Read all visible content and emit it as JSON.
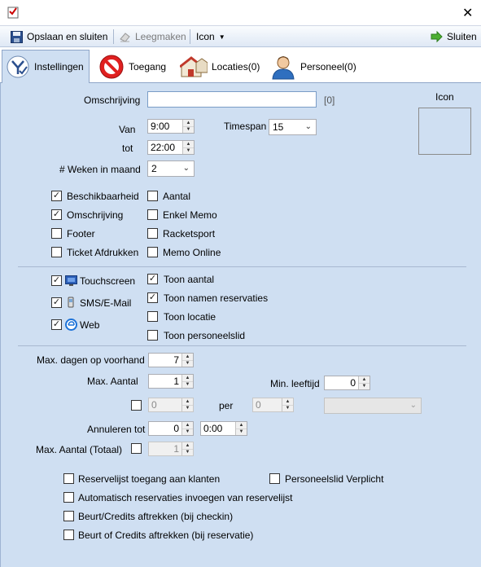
{
  "window": {
    "close_symbol": "✕"
  },
  "toolbar": {
    "save_close": "Opslaan en sluiten",
    "clear": "Leegmaken",
    "icon": "Icon",
    "close": "Sluiten"
  },
  "tabs": [
    {
      "label": "Instellingen",
      "active": true
    },
    {
      "label": "Toegang"
    },
    {
      "label": "Locaties(0)"
    },
    {
      "label": "Personeel(0)"
    }
  ],
  "form": {
    "omschrijving_label": "Omschrijving",
    "omschrijving_value": "",
    "omschrijving_count": "[0]",
    "icon_label": "Icon",
    "van_label": "Van",
    "van_value": "9:00",
    "tot_label": "tot",
    "tot_value": "22:00",
    "timespan_label": "Timespan",
    "timespan_value": "15",
    "weken_label": "# Weken in maand",
    "weken_value": "2"
  },
  "checks_group1": [
    {
      "label": "Beschikbaarheid",
      "checked": true
    },
    {
      "label": "Omschrijving",
      "checked": true
    },
    {
      "label": "Footer",
      "checked": false
    },
    {
      "label": "Ticket Afdrukken",
      "checked": false
    },
    {
      "label": "Aantal",
      "checked": false
    },
    {
      "label": "Enkel Memo",
      "checked": false
    },
    {
      "label": "Racketsport",
      "checked": false
    },
    {
      "label": "Memo Online",
      "checked": false
    }
  ],
  "checks_group2": [
    {
      "label": "Touchscreen",
      "checked": true,
      "icon": "monitor-icon"
    },
    {
      "label": "SMS/E-Mail",
      "checked": true,
      "icon": "phone-icon"
    },
    {
      "label": "Web",
      "checked": true,
      "icon": "ie-icon"
    },
    {
      "label": "Toon aantal",
      "checked": true
    },
    {
      "label": "Toon namen reservaties",
      "checked": true
    },
    {
      "label": "Toon locatie",
      "checked": false
    },
    {
      "label": "Toon personeelslid",
      "checked": false
    }
  ],
  "limits": {
    "max_dagen_label": "Max. dagen op voorhand",
    "max_dagen_value": "7",
    "max_aantal_label": "Max. Aantal",
    "max_aantal_value": "1",
    "min_leeftijd_label": "Min. leeftijd",
    "min_leeftijd_value": "0",
    "per_value1": "0",
    "per_label": "per",
    "per_value2": "0",
    "annuleren_label": "Annuleren tot",
    "annuleren_value": "0",
    "annuleren_time": "0:00",
    "max_totaal_label": "Max. Aantal (Totaal)",
    "max_totaal_value": "1"
  },
  "checks_bottom": [
    {
      "label": "Reservelijst toegang aan klanten",
      "checked": false
    },
    {
      "label": "Automatisch reservaties invoegen van reservelijst",
      "checked": false
    },
    {
      "label": "Beurt/Credits aftrekken (bij checkin)",
      "checked": false
    },
    {
      "label": "Beurt of Credits aftrekken (bij reservatie)",
      "checked": false
    },
    {
      "label": "Personeelslid Verplicht",
      "checked": false
    }
  ]
}
